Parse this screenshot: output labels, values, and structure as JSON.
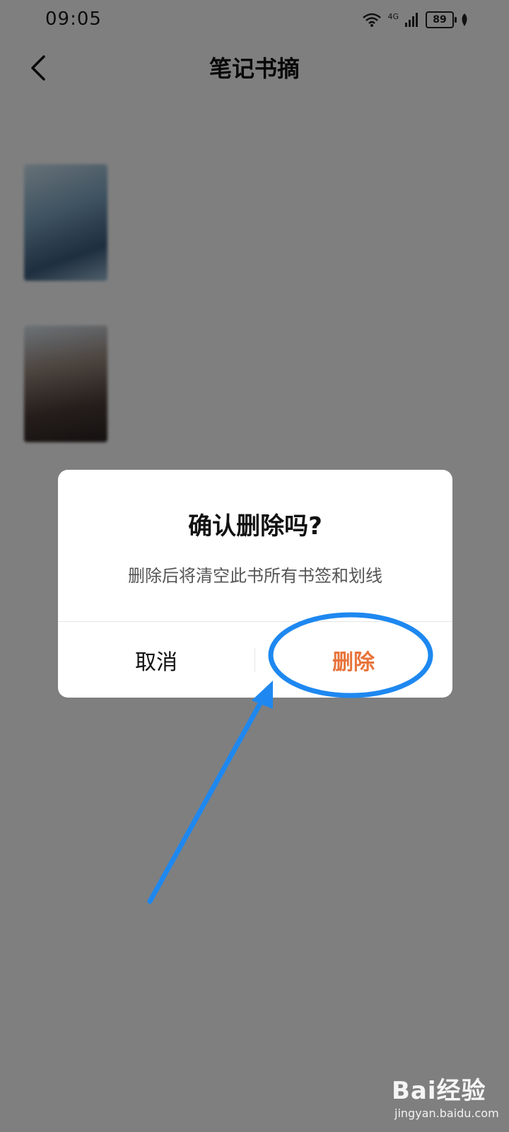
{
  "status_bar": {
    "time": "09:05",
    "network_label": "4G",
    "battery_level": "89"
  },
  "header": {
    "title": "笔记书摘",
    "back_icon": "chevron-left-icon"
  },
  "section_label": "",
  "books": [
    {
      "title": "",
      "meta": ""
    },
    {
      "title": "",
      "meta": ""
    }
  ],
  "dialog": {
    "title": "确认删除吗?",
    "message": "删除后将清空此书所有书签和划线",
    "cancel_label": "取消",
    "delete_label": "删除"
  },
  "colors": {
    "delete_accent": "#e8743b",
    "annotation_blue": "#1e88f0",
    "overlay": "rgba(0,0,0,0.5)"
  },
  "watermark": {
    "brand": "Bai经验",
    "site": "jingyan.baidu.com"
  }
}
